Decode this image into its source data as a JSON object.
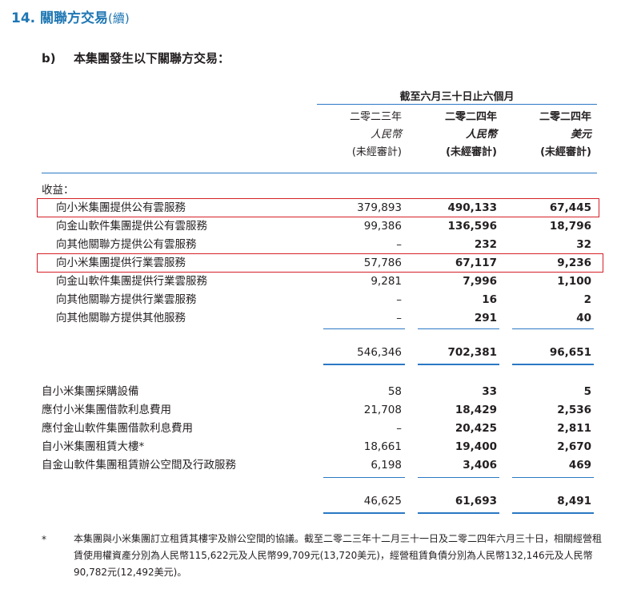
{
  "section": {
    "number": "14.",
    "title": "關聯方交易",
    "continued": "(續)"
  },
  "subsection": {
    "letter": "b)",
    "title": "本集團發生以下關聯方交易："
  },
  "table": {
    "period_header": "截至六月三十日止六個月",
    "columns": [
      {
        "year": "二零二三年",
        "currency": "人民幣",
        "audit": "(未經審計)"
      },
      {
        "year": "二零二四年",
        "currency": "人民幣",
        "audit": "(未經審計)"
      },
      {
        "year": "二零二四年",
        "currency": "美元",
        "audit": "(未經審計)"
      }
    ],
    "revenue_heading": "收益：",
    "revenue_rows": [
      {
        "label": "向小米集團提供公有雲服務",
        "v2023": "379,893",
        "v2024": "490,133",
        "usd": "67,445"
      },
      {
        "label": "向金山軟件集團提供公有雲服務",
        "v2023": "99,386",
        "v2024": "136,596",
        "usd": "18,796"
      },
      {
        "label": "向其他關聯方提供公有雲服務",
        "v2023": "–",
        "v2024": "232",
        "usd": "32"
      },
      {
        "label": "向小米集團提供行業雲服務",
        "v2023": "57,786",
        "v2024": "67,117",
        "usd": "9,236"
      },
      {
        "label": "向金山軟件集團提供行業雲服務",
        "v2023": "9,281",
        "v2024": "7,996",
        "usd": "1,100"
      },
      {
        "label": "向其他關聯方提供行業雲服務",
        "v2023": "–",
        "v2024": "16",
        "usd": "2"
      },
      {
        "label": "向其他關聯方提供其他服務",
        "v2023": "–",
        "v2024": "291",
        "usd": "40"
      }
    ],
    "revenue_total": {
      "v2023": "546,346",
      "v2024": "702,381",
      "usd": "96,651"
    },
    "other_rows": [
      {
        "label": "自小米集團採購設備",
        "v2023": "58",
        "v2024": "33",
        "usd": "5"
      },
      {
        "label": "應付小米集團借款利息費用",
        "v2023": "21,708",
        "v2024": "18,429",
        "usd": "2,536"
      },
      {
        "label": "應付金山軟件集團借款利息費用",
        "v2023": "–",
        "v2024": "20,425",
        "usd": "2,811"
      },
      {
        "label": "自小米集團租賃大樓*",
        "v2023": "18,661",
        "v2024": "19,400",
        "usd": "2,670"
      },
      {
        "label": "自金山軟件集團租賃辦公空間及行政服務",
        "v2023": "6,198",
        "v2024": "3,406",
        "usd": "469"
      }
    ],
    "other_total": {
      "v2023": "46,625",
      "v2024": "61,693",
      "usd": "8,491"
    }
  },
  "footnote": {
    "mark": "*",
    "text": "本集團與小米集團訂立租賃其樓宇及辦公空間的協議。截至二零二三年十二月三十一日及二零二四年六月三十日，相關經營租賃使用權資產分別為人民幣115,622元及人民幣99,709元(13,720美元)，經營租賃負債分別為人民幣132,146元及人民幣90,782元(12,492美元)。"
  },
  "colors": {
    "accent_blue": "#1f77b4",
    "rule_blue": "#2b78c4",
    "highlight_red": "#d62027"
  }
}
